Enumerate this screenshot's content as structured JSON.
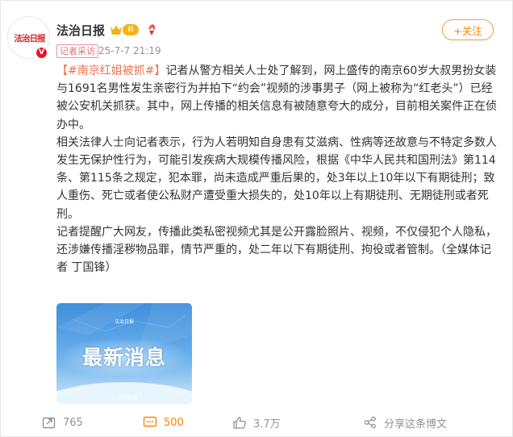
{
  "header": {
    "username": "法治日报",
    "level_badge": "II",
    "source_tag": "记者采访",
    "post_time": "25-7-7 21:19",
    "follow_label": "+关注",
    "verified_mark": "V",
    "avatar_text": "法治日报"
  },
  "post": {
    "hashtag": "【#南京红姐被抓#】",
    "paragraph1": "记者从警方相关人士处了解到，网上盛传的南京60岁大叔男扮女装与1691名男性发生亲密行为并拍下“约会”视频的涉事男子（网上被称为“红老头”）已经被公安机关抓获。其中，网上传播的相关信息有被随意夸大的成分，目前相关案件正在侦办中。",
    "paragraph2": "相关法律人士向记者表示，行为人若明知自身患有艾滋病、性病等还故意与不特定多数人发生无保护性行为，可能引发疾病大规模传播风险，根据《中华人民共和国刑法》第114条、第115条之规定，犯本罪，尚未造成严重后果的，处3年以上10年以下有期徒刑；致人重伤、死亡或者使公私财产遭受重大损失的，处10年以上有期徒刑、无期徒刑或者死刑。",
    "paragraph3": "记者提醒广大网友，传播此类私密视频尤其是公开露脸照片、视频，不仅侵犯个人隐私，还涉嫌传播淫秽物品罪，情节严重的，处二年以下有期徒刑、拘役或者管制。（全媒体记者 丁国锋）"
  },
  "image": {
    "headline": "最新消息",
    "logo_top": "法治日报",
    "logo_bottom": "◎ 法治日报"
  },
  "actions": {
    "repost_count": "765",
    "comment_count": "500",
    "like_count": "3.7万",
    "share_label": "分享这条博文"
  },
  "colors": {
    "brand_orange": "#ff8200",
    "hashtag": "#eb7350",
    "verified_red": "#e6162d",
    "meta_gray": "#939393"
  }
}
